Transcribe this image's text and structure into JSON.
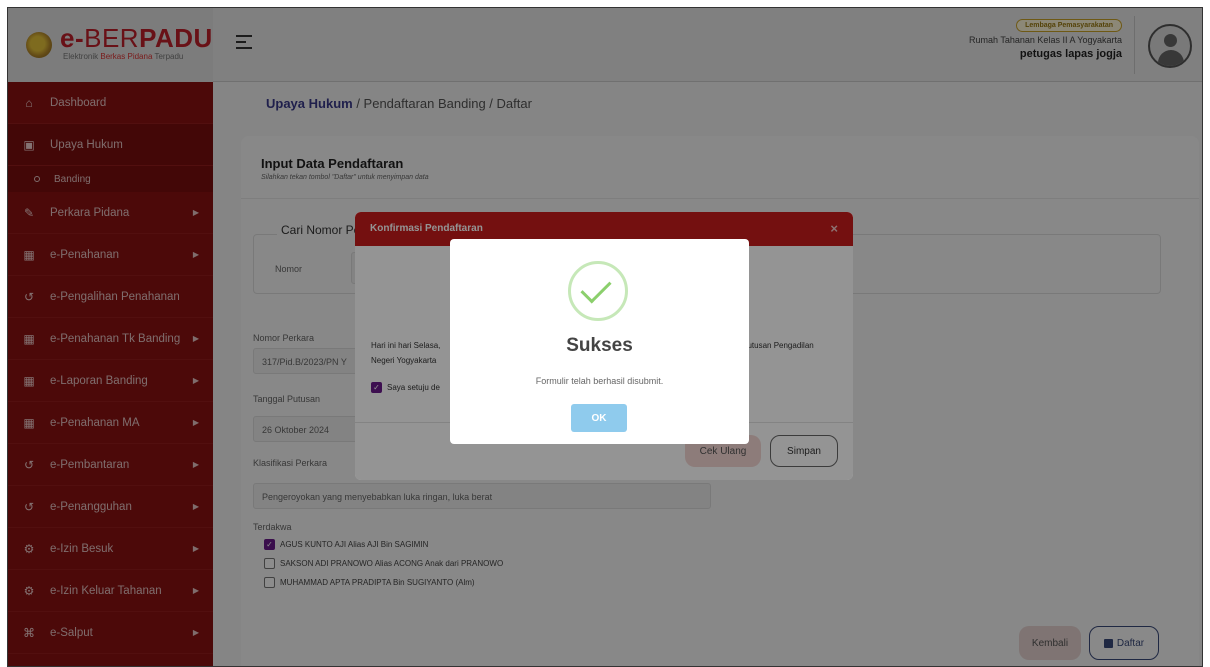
{
  "header": {
    "brand_prefix": "e-",
    "brand_mid": "BER",
    "brand_suffix": "PADU",
    "brand_sub_1": "Elektronik ",
    "brand_sub_2": "Berkas Pidana",
    "brand_sub_3": " Terpadu",
    "institution_badge": "Lembaga Pemasyarakatan",
    "institution_name": "Rumah Tahanan Kelas II A Yogyakarta",
    "user_name": "petugas lapas jogja"
  },
  "sidebar": {
    "items": [
      {
        "label": "Dashboard",
        "icon": "home-icon"
      },
      {
        "label": "Upaya Hukum",
        "icon": "copy-icon"
      },
      {
        "label": "Banding",
        "icon": "dot-icon"
      },
      {
        "label": "Perkara Pidana",
        "icon": "edit-icon"
      },
      {
        "label": "e-Penahanan",
        "icon": "grid-icon"
      },
      {
        "label": "e-Pengalihan Penahanan",
        "icon": "history-icon"
      },
      {
        "label": "e-Penahanan Tk Banding",
        "icon": "grid-icon"
      },
      {
        "label": "e-Laporan Banding",
        "icon": "grid-icon"
      },
      {
        "label": "e-Penahanan MA",
        "icon": "grid-icon"
      },
      {
        "label": "e-Pembantaran",
        "icon": "history-icon"
      },
      {
        "label": "e-Penangguhan",
        "icon": "history-icon"
      },
      {
        "label": "e-Izin Besuk",
        "icon": "gear-icon"
      },
      {
        "label": "e-Izin Keluar Tahanan",
        "icon": "gear-icon"
      },
      {
        "label": "e-Salput",
        "icon": "link-icon"
      }
    ]
  },
  "breadcrumb": {
    "root": "Upaya Hukum",
    "rest": " / Pendaftaran Banding / Daftar"
  },
  "form": {
    "title": "Input Data Pendaftaran",
    "subtitle": "Silahkan tekan tombol \"Daftar\" untuk menyimpan data",
    "search_legend": "Cari Nomor Pe",
    "nomor_label": "Nomor",
    "nomor_perkara_label": "Nomor Perkara",
    "nomor_perkara_value": "317/Pid.B/2023/PN Y",
    "tanggal_putusan_label": "Tanggal Putusan",
    "tanggal_putusan_value": "26 Oktober 2024",
    "klasifikasi_label": "Klasifikasi Perkara",
    "klasifikasi_value": "Pengeroyokan yang menyebabkan luka ringan, luka berat",
    "terdakwa_label": "Terdakwa",
    "terdakwa": [
      {
        "name": "AGUS KUNTO AJI Alias AJI Bin SAGIMIN",
        "checked": true
      },
      {
        "name": "SAKSON ADI PRANOWO Alias ACONG Anak dari PRANOWO",
        "checked": false
      },
      {
        "name": "MUHAMMAD APTA PRADIPTA Bin SUGIYANTO (Alm)",
        "checked": false
      }
    ],
    "kembali_label": "Kembali",
    "daftar_label": "Daftar"
  },
  "confirm_modal": {
    "title": "Konfirmasi Pendaftaran",
    "close": "×",
    "text_left": "Hari ini hari Selasa,",
    "text_right": "putusan Pengadilan",
    "text_line2": "Negeri Yogyakarta",
    "agree_label": "Saya setuju de",
    "cek_ulang_label": "Cek Ulang",
    "simpan_label": "Simpan"
  },
  "success_alert": {
    "title": "Sukses",
    "message": "Formulir telah berhasil disubmit.",
    "ok_label": "OK"
  }
}
